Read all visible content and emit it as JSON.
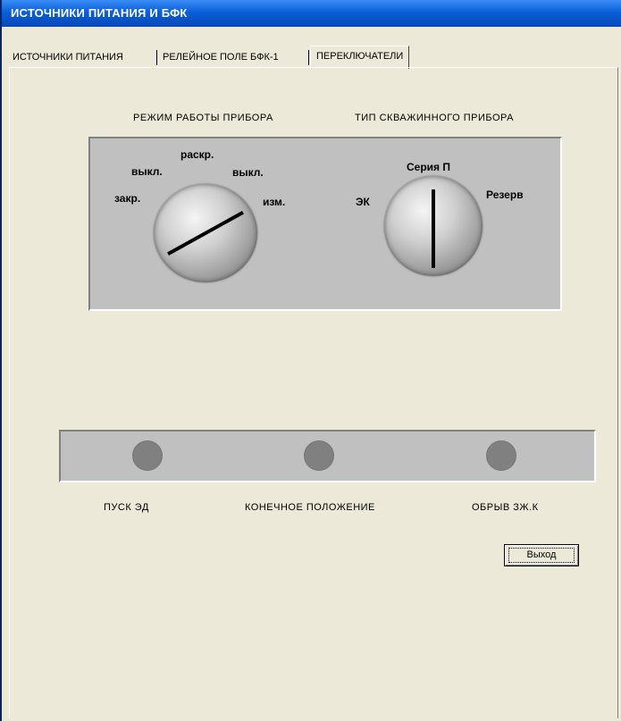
{
  "window": {
    "title": "ИСТОЧНИКИ ПИТАНИЯ И БФК"
  },
  "tabs": [
    {
      "label": "ИСТОЧНИКИ ПИТАНИЯ"
    },
    {
      "label": "РЕЛЕЙНОЕ ПОЛЕ БФК-1"
    },
    {
      "label": "ПЕРЕКЛЮЧАТЕЛИ",
      "active": true
    }
  ],
  "switches": {
    "mode": {
      "title": "РЕЖИМ РАБОТЫ ПРИБОРА",
      "positions": {
        "close": "закр.",
        "off_left": "выкл.",
        "open": "раскр.",
        "off_right": "выкл.",
        "measure": "изм."
      }
    },
    "device_type": {
      "title": "ТИП СКВАЖИННОГО ПРИБОРА",
      "positions": {
        "ek": "ЭК",
        "series_p": "Серия П",
        "reserve": "Резерв"
      }
    }
  },
  "indicators": {
    "start": "ПУСК ЭД",
    "end_position": "КОНЕЧНОЕ ПОЛОЖЕНИЕ",
    "break": "ОБРЫВ ЗЖ.К",
    "led_color": "#808080"
  },
  "buttons": {
    "exit": "Выход"
  }
}
